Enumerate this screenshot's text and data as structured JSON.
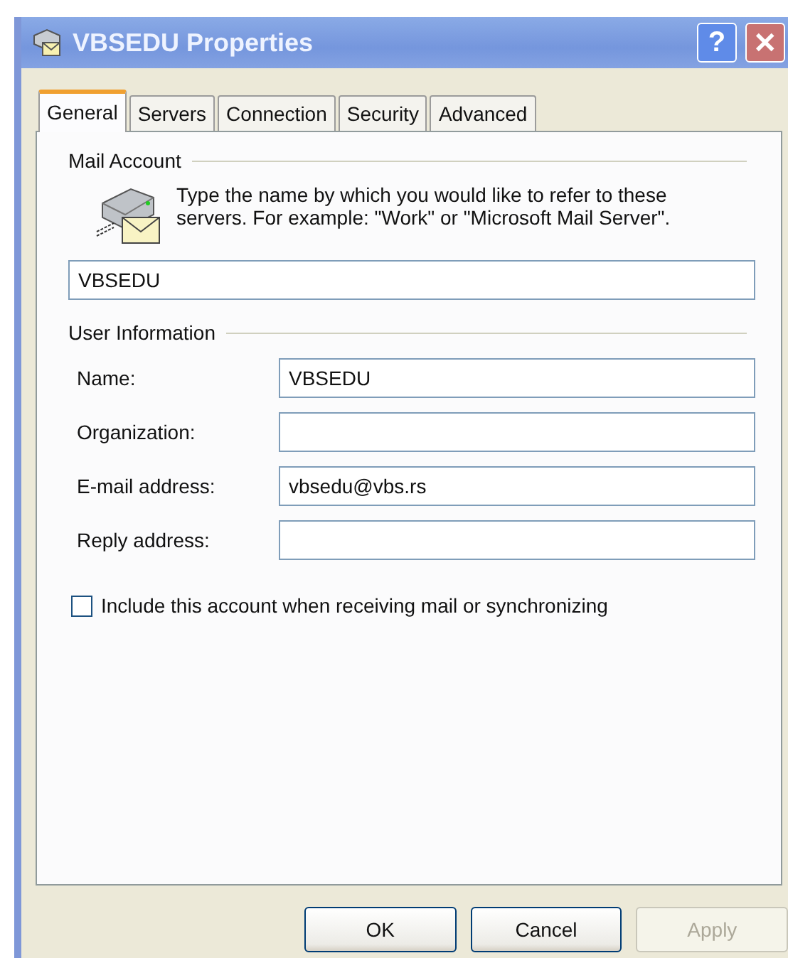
{
  "window": {
    "title": "VBSEDU Properties",
    "help": "?",
    "close": "✕"
  },
  "tabs": [
    {
      "label": "General",
      "selected": true
    },
    {
      "label": "Servers",
      "selected": false
    },
    {
      "label": "Connection",
      "selected": false
    },
    {
      "label": "Security",
      "selected": false
    },
    {
      "label": "Advanced",
      "selected": false
    }
  ],
  "mail_account": {
    "heading": "Mail Account",
    "description": "Type the name by which you would like to refer to these servers.  For example: \"Work\" or \"Microsoft Mail Server\".",
    "value": "VBSEDU"
  },
  "user_information": {
    "heading": "User Information",
    "fields": [
      {
        "label": "Name:",
        "value": "VBSEDU"
      },
      {
        "label": "Organization:"
      },
      {
        "label": "E-mail address:",
        "value": "vbsedu@vbs.rs"
      },
      {
        "label": "Reply address:"
      }
    ]
  },
  "include_checkbox": {
    "label": "Include this account when receiving mail or synchronizing",
    "checked": false
  },
  "buttons": [
    {
      "label": "OK",
      "disabled": false
    },
    {
      "label": "Cancel",
      "disabled": false
    },
    {
      "label": "Apply",
      "disabled": true
    }
  ]
}
